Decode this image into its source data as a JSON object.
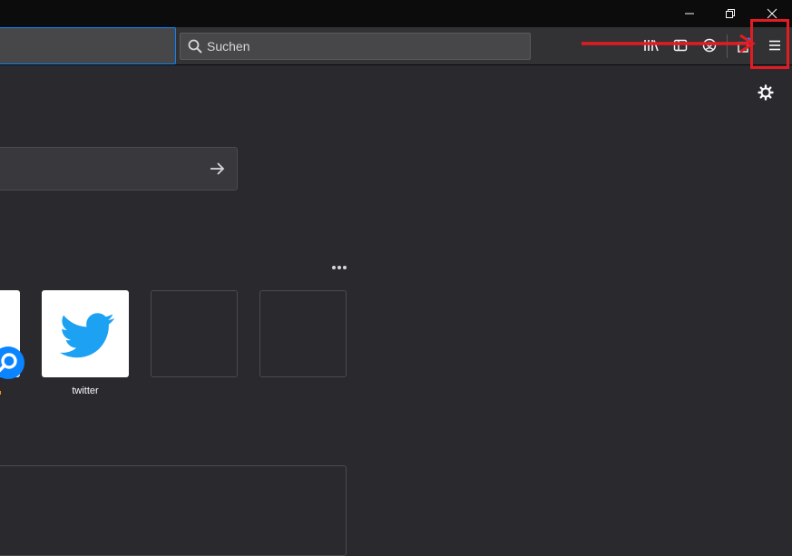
{
  "window": {
    "minimize_icon": "minimize-icon",
    "restore_icon": "restore-icon",
    "close_icon": "close-icon"
  },
  "toolbar": {
    "search": {
      "placeholder": "Suchen",
      "icon": "search-icon"
    },
    "icons": [
      "library-icon",
      "sidebar-icon",
      "sync-account-icon",
      "extension-icon",
      "hamburger-menu-icon"
    ]
  },
  "annotation": {
    "color": "#e31b23",
    "target": "hamburger-menu-icon"
  },
  "newtab": {
    "settings_icon": "gear-icon",
    "search_go_icon": "arrow-right-icon",
    "more_icon": "more-dots-icon",
    "tiles": [
      {
        "label": "",
        "kind": "partial"
      },
      {
        "label": "twitter",
        "kind": "twitter"
      },
      {
        "label": "",
        "kind": "empty"
      },
      {
        "label": "",
        "kind": "empty"
      }
    ]
  },
  "colors": {
    "accent": "#0a84ff",
    "twitter_blue": "#1da1f2",
    "background": "#2a2a2e"
  }
}
